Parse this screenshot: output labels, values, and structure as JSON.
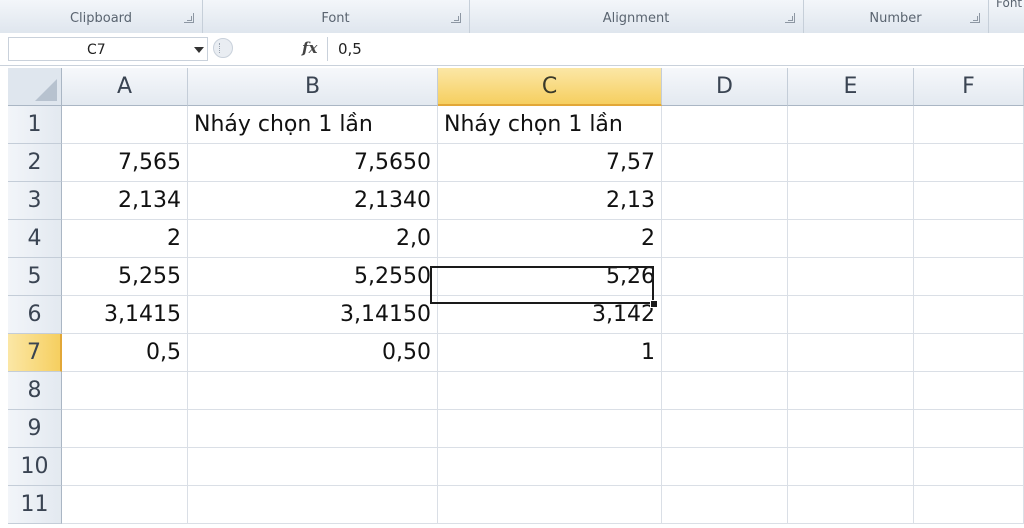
{
  "ribbon": {
    "groups": [
      {
        "label": "Clipboard"
      },
      {
        "label": "Font"
      },
      {
        "label": "Alignment"
      },
      {
        "label": "Number"
      }
    ],
    "cut_text": "Font"
  },
  "formula_bar": {
    "name_box": "C7",
    "fx_label": "fx",
    "formula": "0,5"
  },
  "sheet": {
    "columns": [
      "A",
      "B",
      "C",
      "D",
      "E",
      "F"
    ],
    "rows": [
      "1",
      "2",
      "3",
      "4",
      "5",
      "6",
      "7",
      "8",
      "9",
      "10",
      "11"
    ],
    "selected_column": "C",
    "selected_row": "7",
    "cells": {
      "B1": "Nháy chọn 1 lần",
      "C1": "Nháy chọn 1 lần",
      "A2": "7,565",
      "B2": "7,5650",
      "C2": "7,57",
      "A3": "2,134",
      "B3": "2,1340",
      "C3": "2,13",
      "A4": "2",
      "B4": "2,0",
      "C4": "2",
      "A5": "5,255",
      "B5": "5,2550",
      "C5": "5,26",
      "A6": "3,1415",
      "B6": "3,14150",
      "C6": "3,142",
      "A7": "0,5",
      "B7": "0,50",
      "C7": "1"
    }
  }
}
